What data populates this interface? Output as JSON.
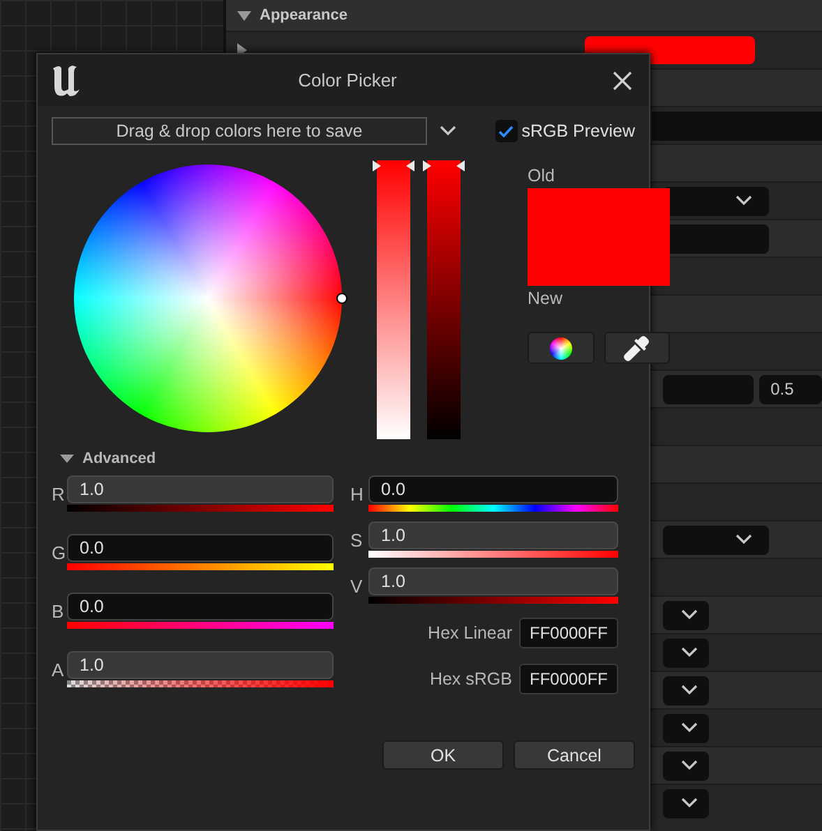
{
  "editor_panel": {
    "section": {
      "label": "Appearance",
      "expanded": true
    },
    "rows": [
      {
        "kind": "color",
        "color": "#ff0000"
      },
      {
        "kind": "plain"
      },
      {
        "kind": "wide-field"
      },
      {
        "kind": "plain"
      },
      {
        "kind": "dropdown"
      },
      {
        "kind": "field"
      },
      {
        "kind": "plain"
      },
      {
        "kind": "plain"
      },
      {
        "kind": "plain"
      },
      {
        "kind": "number",
        "value": "0.5"
      },
      {
        "kind": "plain"
      },
      {
        "kind": "plain"
      },
      {
        "kind": "plain"
      },
      {
        "kind": "dropdown"
      },
      {
        "kind": "plain"
      },
      {
        "kind": "small-dropdown"
      },
      {
        "kind": "small-dropdown"
      },
      {
        "kind": "small-dropdown"
      },
      {
        "kind": "small-dropdown"
      },
      {
        "kind": "small-dropdown"
      },
      {
        "kind": "small-dropdown"
      }
    ]
  },
  "color_picker": {
    "title": "Color Picker",
    "save_bar": {
      "label": "Drag & drop colors here to save"
    },
    "srgb_preview": {
      "label": "sRGB Preview",
      "checked": true
    },
    "saturation_slider": {
      "level": 1
    },
    "value_slider": {
      "level": 1
    },
    "old": {
      "label": "Old",
      "color": "#ff0000"
    },
    "new": {
      "label": "New",
      "color": "#ff0000"
    },
    "advanced": {
      "label": "Advanced",
      "expanded": true
    },
    "channels": [
      {
        "label": "R",
        "value": "1.0",
        "highlighted": true
      },
      {
        "label": "G",
        "value": "0.0",
        "highlighted": false
      },
      {
        "label": "B",
        "value": "0.0",
        "highlighted": false
      },
      {
        "label": "A",
        "value": "1.0",
        "highlighted": true
      }
    ],
    "hsv": [
      {
        "label": "H",
        "value": "0.0",
        "highlighted": false
      },
      {
        "label": "S",
        "value": "1.0",
        "highlighted": true
      },
      {
        "label": "V",
        "value": "1.0",
        "highlighted": true
      }
    ],
    "hex": [
      {
        "label": "Hex Linear",
        "value": "FF0000FF"
      },
      {
        "label": "Hex sRGB",
        "value": "FF0000FF"
      }
    ],
    "buttons": [
      {
        "label": "OK"
      },
      {
        "label": "Cancel"
      }
    ]
  }
}
